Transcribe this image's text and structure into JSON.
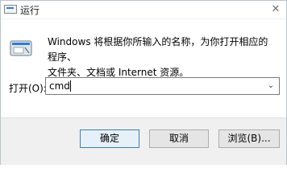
{
  "window": {
    "title": "运行",
    "close_glyph": "✕"
  },
  "dialog": {
    "description_line1": "Windows 将根据你所输入的名称，为你打开相应的程序、",
    "description_line2": "文件夹、文档或 Internet 资源。",
    "open_label": "打开(O):",
    "open_value": "cmd",
    "dropdown_glyph": "⌄"
  },
  "buttons": {
    "ok": "确定",
    "cancel": "取消",
    "browse": "浏览(B)..."
  },
  "colors": {
    "accent": "#2a7ed8",
    "footer_bg": "#f0f0f0",
    "default_button_border": "#3c7fb1"
  }
}
